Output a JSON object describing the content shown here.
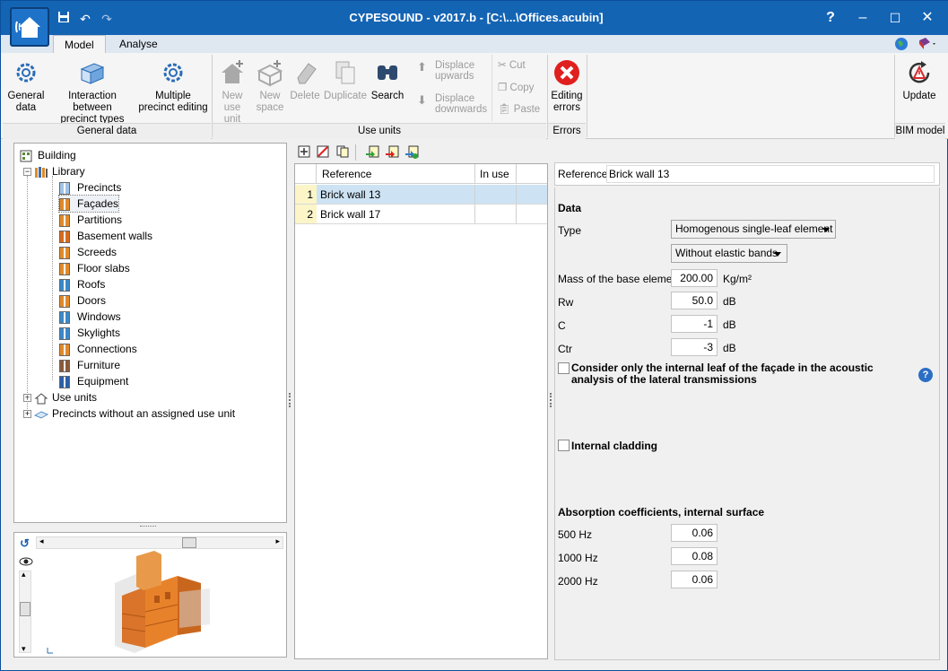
{
  "window": {
    "title": "CYPESOUND - v2017.b - [C:\\...\\Offices.acubin]",
    "help_label": "?",
    "minimize_label": "–",
    "maximize_label": "☐",
    "close_label": "✕"
  },
  "tabs": [
    {
      "label": "Model",
      "active": true
    },
    {
      "label": "Analyse",
      "active": false
    }
  ],
  "ribbon": {
    "general_data": {
      "group_label": "General data",
      "buttons": [
        {
          "label_l1": "General",
          "label_l2": "data"
        },
        {
          "label_l1": "Interaction between",
          "label_l2": "precinct types"
        },
        {
          "label_l1": "Multiple",
          "label_l2": "precinct editing"
        }
      ]
    },
    "use_units": {
      "group_label": "Use units",
      "buttons": [
        {
          "label_l1": "New",
          "label_l2": "use unit"
        },
        {
          "label_l1": "New",
          "label_l2": "space"
        },
        {
          "label_l1": "Delete",
          "label_l2": ""
        },
        {
          "label_l1": "Duplicate",
          "label_l2": ""
        },
        {
          "label_l1": "Search",
          "label_l2": ""
        }
      ],
      "displace_up_l1": "Displace",
      "displace_up_l2": "upwards",
      "displace_down_l1": "Displace",
      "displace_down_l2": "downwards",
      "cut": "Cut",
      "copy": "Copy",
      "paste": "Paste"
    },
    "errors": {
      "group_label": "Errors",
      "button_l1": "Editing",
      "button_l2": "errors"
    },
    "bim": {
      "group_label": "BIM model",
      "button": "Update"
    }
  },
  "tree": {
    "root": "Building",
    "library": "Library",
    "library_items": [
      "Precincts",
      "Façades",
      "Partitions",
      "Basement walls",
      "Screeds",
      "Floor slabs",
      "Roofs",
      "Doors",
      "Windows",
      "Skylights",
      "Connections",
      "Furniture",
      "Equipment"
    ],
    "selected": "Façades",
    "use_units": "Use units",
    "precincts_unassigned": "Precincts without an assigned use unit"
  },
  "list": {
    "col_reference": "Reference",
    "col_in_use": "In use",
    "rows": [
      {
        "index": "1",
        "reference": "Brick wall 13",
        "in_use": ""
      },
      {
        "index": "2",
        "reference": "Brick wall 17",
        "in_use": ""
      }
    ]
  },
  "props": {
    "reference_label": "Reference",
    "reference_value": "Brick wall 13",
    "data_heading": "Data",
    "type_label": "Type",
    "type_value": "Homogenous single-leaf element",
    "elastic_value": "Without elastic bands",
    "mass_label": "Mass of the base element",
    "mass_value": "200.00",
    "mass_unit": "Kg/m²",
    "rw_label": "Rw",
    "rw_value": "50.0",
    "rw_unit": "dB",
    "c_label": "C",
    "c_value": "-1",
    "c_unit": "dB",
    "ctr_label": "Ctr",
    "ctr_value": "-3",
    "ctr_unit": "dB",
    "consider_label_l1": "Consider only the internal leaf of the façade in the acoustic",
    "consider_label_l2": "analysis of the lateral transmissions",
    "internal_cladding_label": "Internal cladding",
    "absorption_heading": "Absorption coefficients, internal surface",
    "abs_rows": [
      {
        "label": "500 Hz",
        "value": "0.06"
      },
      {
        "label": "1000 Hz",
        "value": "0.08"
      },
      {
        "label": "2000 Hz",
        "value": "0.06"
      }
    ]
  },
  "colors": {
    "titlebar": "#1464b4",
    "selection": "#cde3f4",
    "row_index": "#fbf5c8",
    "error_red": "#e0201e",
    "building_orange": "#e8822a"
  }
}
